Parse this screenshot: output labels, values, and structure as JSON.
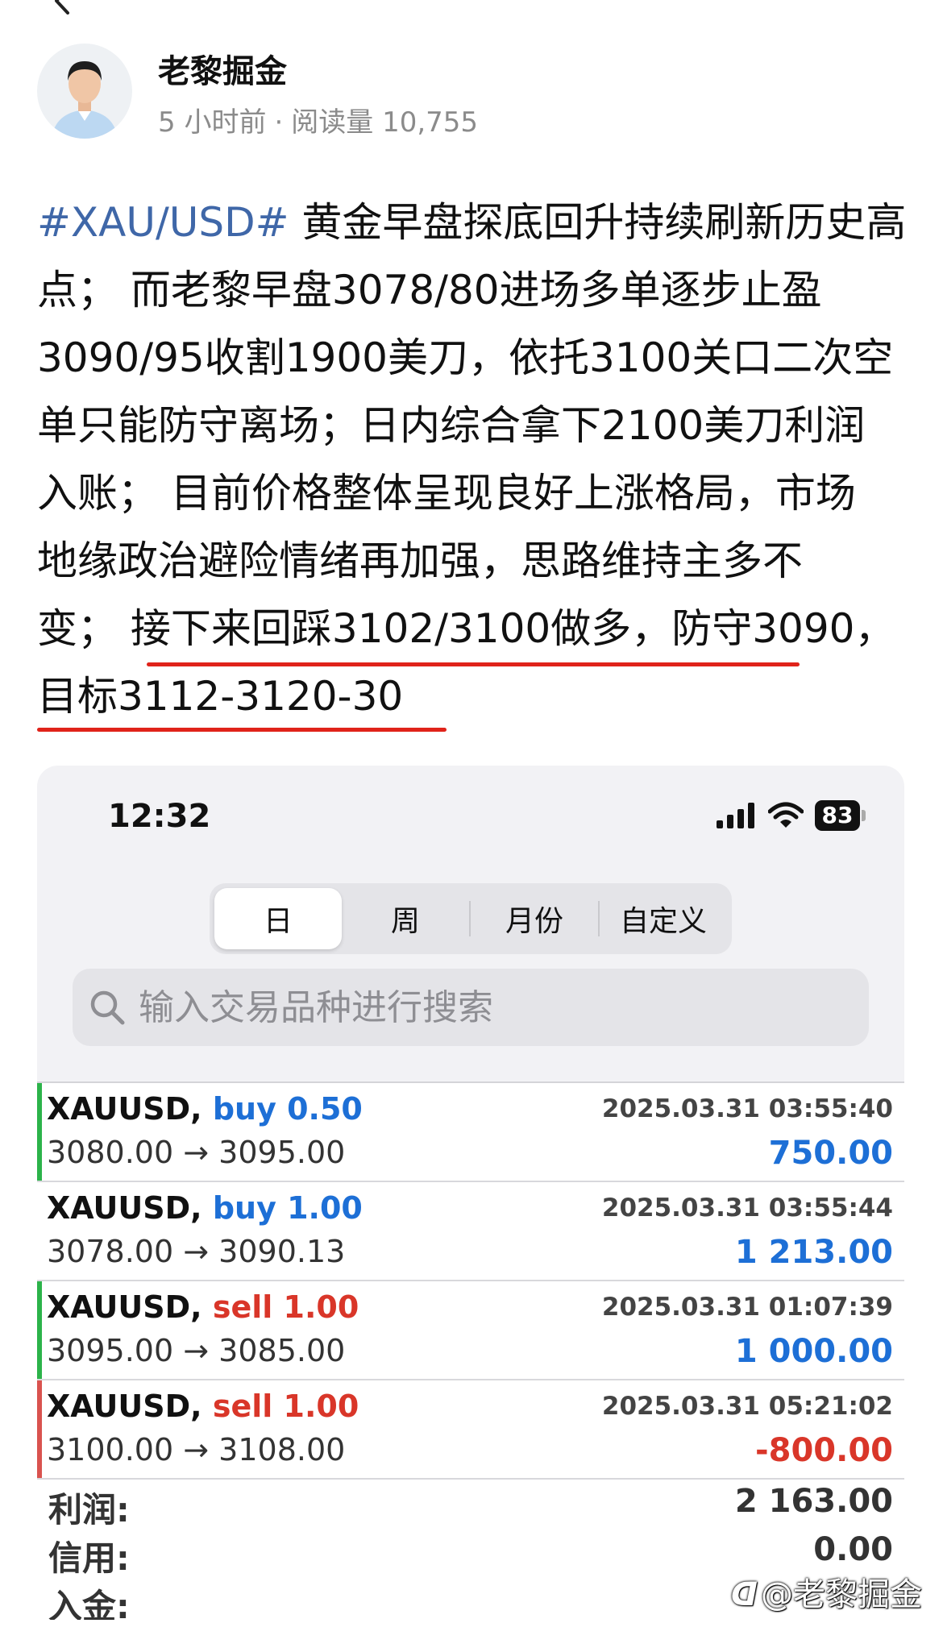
{
  "post": {
    "author_name": "老黎掘金",
    "time_ago": "5 小时前",
    "separator": "·",
    "read_count": "阅读量 10,755",
    "hashtag": "#XAU/USD#",
    "lines": [
      " 黄金早盘探底回升持续刷新历史高",
      "点；  而老黎早盘3078/80进场多单逐步止盈",
      "3090/95收割1900美刀，依托3100关口二次空",
      "单只能防守离场；日内综合拿下2100美刀利润",
      "入账；  目前价格整体呈现良好上涨格局，市场",
      "地缘政治避险情绪再加强，思路维持主多不",
      "变；  接下来回踩3102/3100做多，防守3090，",
      "目标3112-3120-30"
    ]
  },
  "screenshot": {
    "status_time": "12:32",
    "battery": "83",
    "tabs": [
      "日",
      "周",
      "月份",
      "自定义"
    ],
    "active_tab": 0,
    "search_placeholder": "输入交易品种进行搜索",
    "trades": [
      {
        "symbol": "XAUUSD,",
        "side": "buy",
        "volume": "0.50",
        "open": "3080.00",
        "arrow": "→",
        "close": "3095.00",
        "time": "2025.03.31 03:55:40",
        "profit": "750.00",
        "bar_color": "#2cb34a"
      },
      {
        "symbol": "XAUUSD,",
        "side": "buy",
        "volume": "1.00",
        "open": "3078.00",
        "arrow": "→",
        "close": "3090.13",
        "time": "2025.03.31 03:55:44",
        "profit": "1 213.00",
        "bar_color": "#ffffff"
      },
      {
        "symbol": "XAUUSD,",
        "side": "sell",
        "volume": "1.00",
        "open": "3095.00",
        "arrow": "→",
        "close": "3085.00",
        "time": "2025.03.31 01:07:39",
        "profit": "1 000.00",
        "bar_color": "#2cb34a"
      },
      {
        "symbol": "XAUUSD,",
        "side": "sell",
        "volume": "1.00",
        "open": "3100.00",
        "arrow": "→",
        "close": "3108.00",
        "time": "2025.03.31 05:21:02",
        "profit": "-800.00",
        "bar_color": "#d9534f"
      }
    ],
    "summary": {
      "profit_label": "利润:",
      "profit_value": "2 163.00",
      "credit_label": "信用:",
      "credit_value": "0.00",
      "deposit_label": "入金:"
    }
  },
  "watermark": "@老黎掘金",
  "colors": {
    "hashtag": "#3f67a8",
    "buy": "#1d6fd6",
    "sell": "#d93629",
    "underline": "#e0231a"
  },
  "icons": [
    "back-arrow-icon",
    "signal-icon",
    "wifi-icon",
    "battery-icon",
    "search-icon",
    "toutiao-logo-icon"
  ]
}
